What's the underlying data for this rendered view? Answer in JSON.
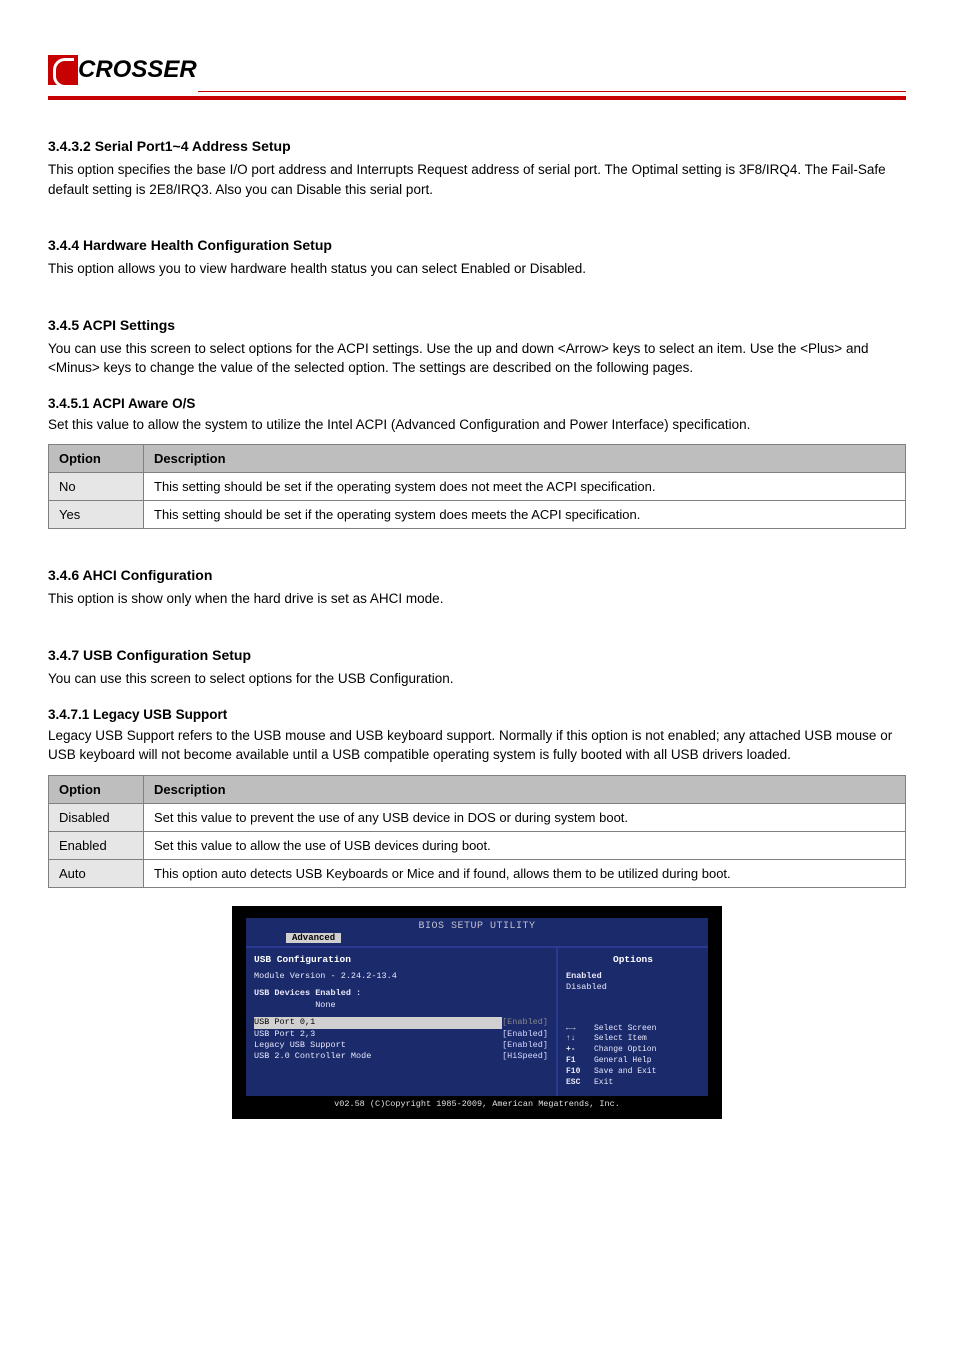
{
  "logo_text": "CROSSER",
  "sec_a": {
    "heading": "3.4.3.2 Serial Port1~4 Address Setup",
    "body": "This option specifies the base I/O port address and Interrupts Request address of serial port. The Optimal setting is 3F8/IRQ4. The Fail-Safe default setting is 2E8/IRQ3. Also you can Disable this serial port."
  },
  "sec_b": {
    "heading": "3.4.4 Hardware Health Configuration Setup",
    "body": "This option allows you to view hardware health status you can select Enabled or Disabled."
  },
  "sec_c": {
    "heading": "3.4.5 ACPI Settings",
    "body": "You can use this screen to select options for the ACPI settings. Use the up and down <Arrow> keys to select an item. Use the <Plus> and <Minus> keys to change the value of the selected option. The settings are described on the following pages.",
    "sub_heading": "3.4.5.1 ACPI Aware O/S",
    "sub_body": "Set this value to allow the system to utilize the Intel ACPI (Advanced Configuration and Power Interface) specification.",
    "table_opt": "Option",
    "table_desc": "Description",
    "rows": [
      {
        "opt": "No",
        "desc": "This setting should be set if the operating system does not meet the ACPI specification."
      },
      {
        "opt": "Yes",
        "desc": "This setting should be set if the operating system does meets the ACPI specification."
      }
    ]
  },
  "sec_d": {
    "heading": "3.4.6 AHCI Configuration",
    "body": "This option is show only when the hard drive is set as AHCI mode."
  },
  "sec_e": {
    "heading": "3.4.7 USB Configuration Setup",
    "body": "You can use this screen to select options for the USB Configuration.",
    "sub_heading": "3.4.7.1 Legacy USB Support",
    "sub_body": "Legacy USB Support refers to the USB mouse and USB keyboard support. Normally if this option is not enabled; any attached USB mouse or USB keyboard will not become available until a USB compatible operating system is fully booted with all USB drivers loaded.",
    "table_opt": "Option",
    "table_desc": "Description",
    "rows": [
      {
        "opt": "Disabled",
        "desc": "Set this value to prevent the use of any USB device in DOS or during system boot."
      },
      {
        "opt": "Enabled",
        "desc": "Set this value to allow the use of USB devices during boot."
      },
      {
        "opt": "Auto",
        "desc": "This option auto detects USB Keyboards or Mice and if found, allows them to be utilized during boot."
      }
    ]
  },
  "bios": {
    "title": "BIOS SETUP UTILITY",
    "tab": "Advanced",
    "section": "USB Configuration",
    "module_line": "Module Version - 2.24.2-13.4",
    "devices_head": "USB Devices Enabled :",
    "devices_val": "            None",
    "items": [
      {
        "label": "USB Port 0,1",
        "value": "[Enabled]",
        "selected": true
      },
      {
        "label": "USB Port 2,3",
        "value": "[Enabled]",
        "selected": false
      },
      {
        "label": "Legacy USB Support",
        "value": "[Enabled]",
        "selected": false
      },
      {
        "label": "USB 2.0 Controller Mode",
        "value": "[HiSpeed]",
        "selected": false
      }
    ],
    "options_head": "Options",
    "options": [
      "Enabled",
      "Disabled"
    ],
    "help": [
      {
        "k": "←→",
        "t": "Select Screen"
      },
      {
        "k": "↑↓",
        "t": "Select Item"
      },
      {
        "k": "+-",
        "t": "Change Option"
      },
      {
        "k": "F1",
        "t": "General Help"
      },
      {
        "k": "F10",
        "t": "Save and Exit"
      },
      {
        "k": "ESC",
        "t": "Exit"
      }
    ],
    "footer": "v02.58 (C)Copyright 1985-2009, American Megatrends, Inc."
  }
}
